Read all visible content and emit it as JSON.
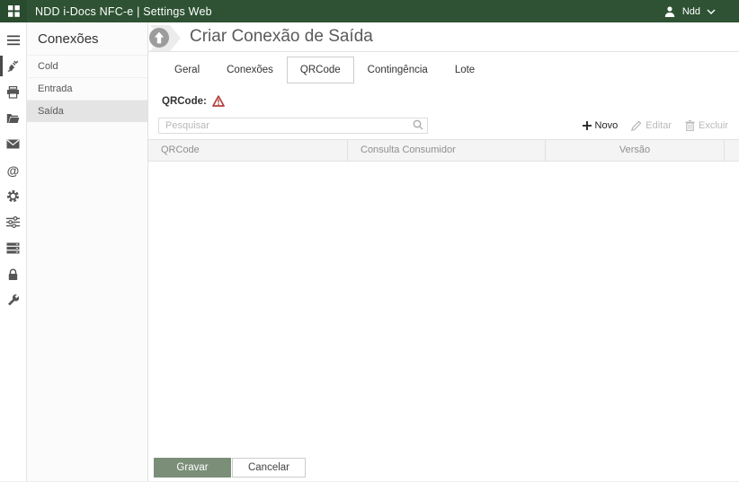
{
  "topbar": {
    "title": "NDD i-Docs NFC-e | Settings Web",
    "user_name": "Ndd"
  },
  "left_rail": {
    "items": [
      "menu-icon",
      "plug-icon",
      "printer-icon",
      "folder-icon",
      "mail-icon",
      "at-icon",
      "gear-icon",
      "sliders-icon",
      "server-icon",
      "lock-icon",
      "wrench-icon"
    ],
    "active_item": "plug-icon"
  },
  "sidebar": {
    "title": "Conexões",
    "items": [
      {
        "label": "Cold",
        "selected": false
      },
      {
        "label": "Entrada",
        "selected": false
      },
      {
        "label": "Saída",
        "selected": true
      }
    ]
  },
  "main": {
    "page_title": "Criar Conexão de Saída",
    "tabs": [
      {
        "label": "Geral",
        "active": false
      },
      {
        "label": "Conexões",
        "active": false
      },
      {
        "label": "QRCode",
        "active": true
      },
      {
        "label": "Contingência",
        "active": false
      },
      {
        "label": "Lote",
        "active": false
      }
    ],
    "section_label": "QRCode:",
    "search": {
      "placeholder": "Pesquisar",
      "value": ""
    },
    "toolbar": {
      "new_label": "Novo",
      "edit_label": "Editar",
      "delete_label": "Excluir"
    },
    "table": {
      "columns": [
        "QRCode",
        "Consulta Consumidor",
        "Versão"
      ],
      "rows": []
    },
    "footer": {
      "save_label": "Gravar",
      "cancel_label": "Cancelar"
    }
  },
  "colors": {
    "topbar_green": "#2e5233",
    "save_green": "#7a8e78",
    "warning_red": "#b23f3c",
    "selected_item_bg": "#e4e4e4"
  }
}
